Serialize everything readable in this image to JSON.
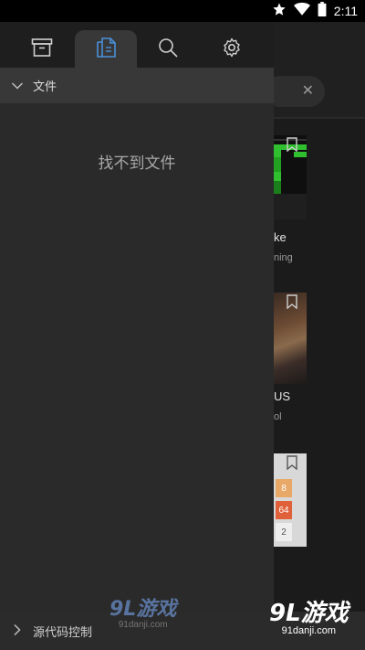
{
  "status_bar": {
    "time": "2:11"
  },
  "drawer": {
    "tabs": [
      {
        "icon": "archive-icon"
      },
      {
        "icon": "files-icon",
        "active": true
      },
      {
        "icon": "search-icon"
      },
      {
        "icon": "gear-icon"
      }
    ],
    "section": {
      "label": "文件"
    },
    "empty_message": "找不到文件"
  },
  "background": {
    "cards": [
      {
        "title": "ke",
        "subtitle": "ning"
      },
      {
        "title": "US",
        "subtitle": "ol"
      },
      {
        "tiles": [
          "8",
          "64",
          "2"
        ]
      }
    ]
  },
  "source_control": {
    "label": "源代码控制"
  },
  "watermark": {
    "logo": "9L游戏",
    "url": "91danji.com"
  },
  "colors": {
    "accent": "#4a90d9",
    "tile_8": "#e8a868",
    "tile_64": "#e0603a",
    "tile_2": "#eeeeee"
  }
}
